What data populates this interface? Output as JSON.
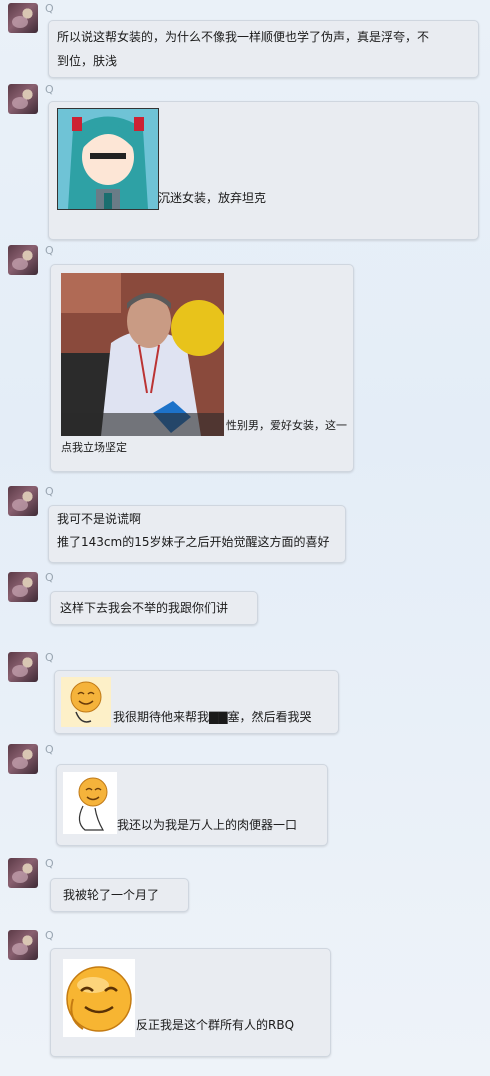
{
  "messages": [
    {
      "sender": "Q",
      "lines": [
        "所以说这帮女装的，为什么不像我一样顺便也学了伪声，真是浮夸，不",
        "到位，肤浅"
      ]
    },
    {
      "sender": "Q",
      "image": "miku-sticker",
      "caption": "沉迷女装，放弃坦克"
    },
    {
      "sender": "Q",
      "image": "man-photo",
      "caption_lines": [
        "性别男，爱好女装，这一",
        "点我立场坚定"
      ]
    },
    {
      "sender": "Q",
      "lines": [
        "我可不是说谎啊",
        "推了143cm的15岁妹子之后开始觉醒这方面的喜好"
      ]
    },
    {
      "sender": "Q",
      "text": "这样下去我会不举的我跟你们讲"
    },
    {
      "sender": "Q",
      "image": "smiley-emoji",
      "caption": "我很期待他来帮我▇▇塞，然后看我哭"
    },
    {
      "sender": "Q",
      "image": "smiley-emoji",
      "caption": "我还以为我是万人上的肉便器一口"
    },
    {
      "sender": "Q",
      "text": "我被轮了一个月了"
    },
    {
      "sender": "Q",
      "image": "smiley-emoji",
      "caption": "反正我是这个群所有人的RBQ"
    }
  ]
}
